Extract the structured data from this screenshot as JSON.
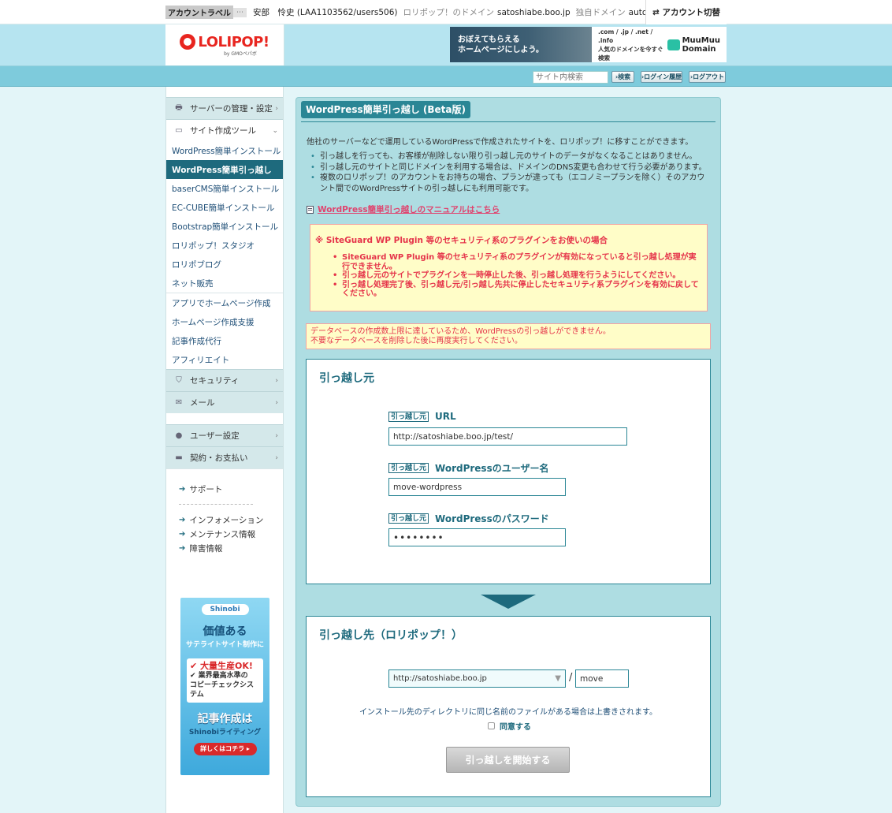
{
  "topbar": {
    "account_label": "アカウントラベル",
    "account_label_more": "⋯",
    "user_name": "安部　怜史 (LAA1103562/users506)",
    "lolipop_domain_label": "ロリポップ！のドメイン",
    "lolipop_domain": "satoshiabe.boo.jp",
    "own_domain_label": "独自ドメイン",
    "own_domain": "autonomous-ch",
    "account_switch": "⇄ アカウント切替"
  },
  "header": {
    "logo_text": "LOLIPOP!",
    "logo_sub": "by GMOペパボ",
    "banner_left": "おぼえてもらえる\nホームページにしよう。",
    "banner_domains": ".com / .jp / .net / .info\n人気のドメインを今すぐ検索",
    "banner_brand": "MuuMuu\nDomain"
  },
  "navstrip": {
    "search_placeholder": "サイト内検索",
    "search_btn": "›検索",
    "history_btn": "›ログイン履歴",
    "logout_btn": "›ログアウト"
  },
  "sidebar": {
    "cat_server": "サーバーの管理・設定",
    "cat_site_tools": "サイト作成ツール",
    "tools": [
      "WordPress簡単インストール",
      "WordPress簡単引っ越し",
      "baserCMS簡単インストール",
      "EC-CUBE簡単インストール",
      "Bootstrap簡単インストール",
      "ロリポップ！スタジオ",
      "ロリポブログ",
      "ネット販売"
    ],
    "extras": [
      "アプリでホームページ作成",
      "ホームページ作成支援",
      "記事作成代行",
      "アフィリエイト"
    ],
    "cat_security": "セキュリティ",
    "cat_mail": "メール",
    "cat_user": "ユーザー設定",
    "cat_contract": "契約・お支払い",
    "support": "サポート",
    "info": "インフォメーション",
    "maintenance": "メンテナンス情報",
    "trouble": "障害情報",
    "ad": {
      "logo": "Shinobi",
      "h1": "価値ある",
      "h2": "サテライトサイト制作に",
      "line1": "✔ 大量生産OK!",
      "line2": "✔ 業界最高水準の\nコピーチェックシステム",
      "h3": "記事作成は",
      "h4": "Shinobiライティング",
      "btn": "詳しくはコチラ ▸"
    }
  },
  "main": {
    "title": "WordPress簡単引っ越し (Beta版)",
    "intro": "他社のサーバーなどで運用しているWordPressで作成されたサイトを、ロリポップ！に移すことができます。",
    "bullets": [
      "引っ越しを行っても、お客様が削除しない限り引っ越し元のサイトのデータがなくなることはありません。",
      "引っ越し元のサイトと同じドメインを利用する場合は、ドメインのDNS変更も合わせて行う必要があります。",
      "複数のロリポップ！のアカウントをお持ちの場合、プランが違っても（エコノミープランを除く）そのアカウント間でのWordPressサイトの引っ越しにも利用可能です。"
    ],
    "manual_link": "WordPress簡単引っ越しのマニュアルはこちら",
    "warning": {
      "title": "※ SiteGuard WP Plugin 等のセキュリティ系のプラグインをお使いの場合",
      "items": [
        "SiteGuard WP Plugin 等のセキュリティ系のプラグインが有効になっていると引っ越し処理が実行できません。",
        "引っ越し元のサイトでプラグインを一時停止した後、引っ越し処理を行うようにしてください。",
        "引っ越し処理完了後、引っ越し元/引っ越し先共に停止したセキュリティ系プラグインを有効に戻してください。"
      ]
    },
    "error": "データベースの作成数上限に達しているため、WordPressの引っ越しができません。\n不要なデータベースを削除した後に再度実行してください。",
    "source": {
      "title": "引っ越し元",
      "tag": "引っ越し元",
      "url_label": "URL",
      "url_value": "http://satoshiabe.boo.jp/test/",
      "user_label": "WordPressのユーザー名",
      "user_value": "move-wordpress",
      "pw_label": "WordPressのパスワード",
      "pw_value": "••••••••"
    },
    "dest": {
      "title": "引っ越し先（ロリポップ！）",
      "domain_selected": "http://satoshiabe.boo.jp",
      "slash": "/",
      "dir_value": "move",
      "note": "インストール先のディレクトリに同じ名前のファイルがある場合は上書きされます。",
      "agree": "同意する",
      "agree_checked": false,
      "start_btn": "引っ越しを開始する"
    }
  },
  "colors": {
    "accent": "#1e6a7d",
    "header_bg": "#b6e4f0",
    "panel_bg": "#aedde2",
    "warning_text": "#e5344a",
    "warning_bg": "#fffdc8",
    "logo_red": "#e8251f"
  }
}
